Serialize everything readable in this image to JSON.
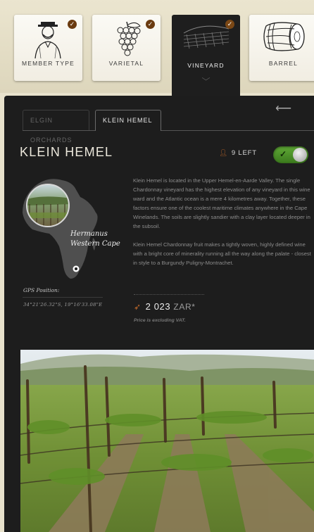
{
  "categories": [
    {
      "label": "MEMBER TYPE",
      "checked": true,
      "icon": "gentleman-icon"
    },
    {
      "label": "VARIETAL",
      "checked": true,
      "icon": "grapes-icon"
    },
    {
      "label": "VINEYARD",
      "checked": true,
      "active": true,
      "icon": "vineyard-icon"
    },
    {
      "label": "BARREL",
      "checked": false,
      "icon": "barrel-icon"
    }
  ],
  "tabs": [
    {
      "label": "ELGIN ORCHARDS",
      "active": false
    },
    {
      "label": "KLEIN HEMEL",
      "active": true
    }
  ],
  "vineyard": {
    "name": "KLEIN HEMEL",
    "stock": "9 LEFT",
    "location_line1": "Hermanus",
    "location_line2": "Western Cape",
    "gps_label": "GPS Position:",
    "gps_value": "34°21'26.32\"S, 19°16'33.08\"E",
    "description_1": "Klein Hemel is located in the Upper Hemel-en-Aarde Valley. The single Chardonnay vineyard has the highest elevation of any vineyard in this wine ward and the Atlantic ocean is a mere 4 kilometres away. Together, these factors ensure one of the coolest maritime climates anywhere in the Cape Winelands. The soils are slightly sandier with a clay layer located deeper in the subsoil.",
    "description_2": "Klein Hemel Chardonnay fruit makes a tightly woven, highly defined wine with a bright core of minerality running all the way along the palate - closest in style to a Burgundy Puligny-Montrachet.",
    "price": "2 023",
    "currency": "ZAR*",
    "vat_note": "Price is excluding VAT.",
    "selected": true
  },
  "colors": {
    "panel": "#1d1d1d",
    "accent_brown": "#6b3b10",
    "accent_orange": "#c46a2a",
    "toggle_green": "#4c9228"
  }
}
